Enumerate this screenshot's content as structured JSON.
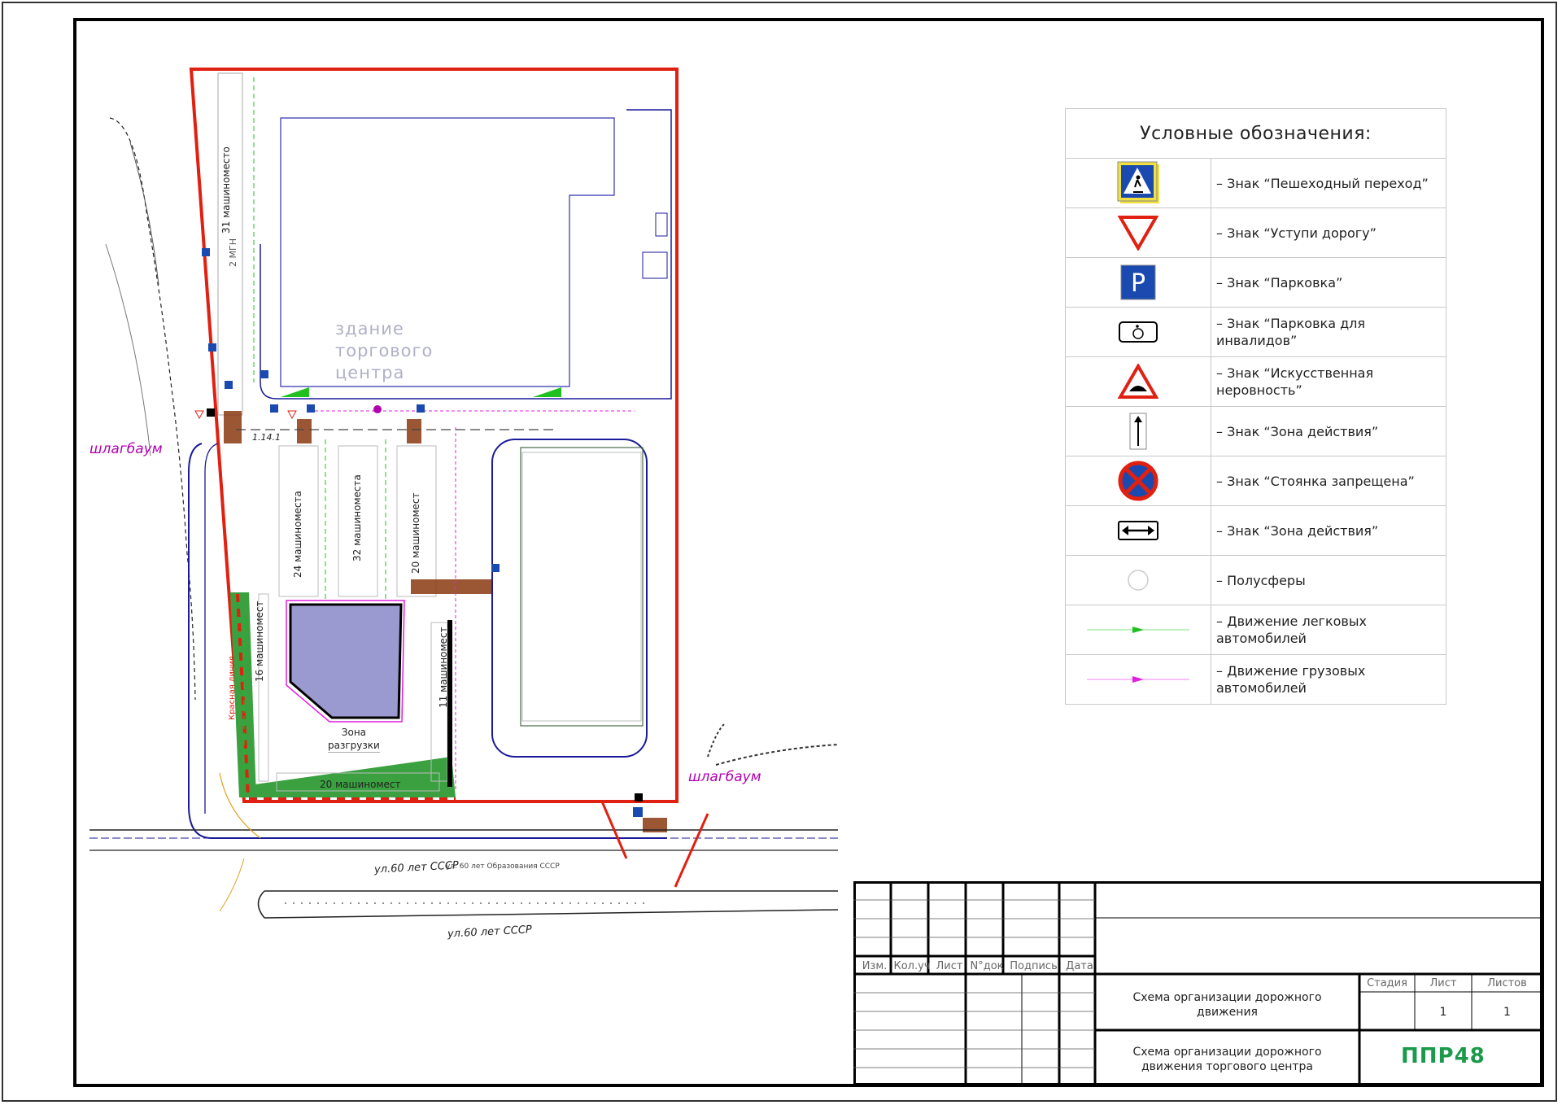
{
  "plan": {
    "building_label": "здание\nторгового\nцентра",
    "barrier_left": "шлагбаум",
    "barrier_right": "шлагбаум",
    "parking_31": "31 машиноместо",
    "parking_24": "24 машиноместа",
    "parking_32": "32 машиноместа",
    "parking_20_vert": "20 машиномест",
    "parking_16": "16 машиномест",
    "parking_11": "11 машиномест",
    "parking_20_horiz": "20 машиномест",
    "mgn": "2 МГН",
    "unload_zone": "Зона\nразгрузки",
    "sign_1141": "1.14.1",
    "red_line": "Красная линия",
    "street_main": "ул.60 лет СССР",
    "street_small": "ул. 60 лет Образования СССР",
    "street_bottom": "ул.60 лет СССР"
  },
  "legend": {
    "title": "Условные обозначения:",
    "items": [
      {
        "icon": "pedestrian-crossing-sign",
        "text": "– Знак “Пешеходный переход”"
      },
      {
        "icon": "give-way-sign",
        "text": "– Знак “Уступи дорогу”"
      },
      {
        "icon": "parking-sign",
        "text": "– Знак “Парковка”"
      },
      {
        "icon": "disabled-parking-sign",
        "text": "– Знак “Парковка для\nинвалидов”"
      },
      {
        "icon": "speed-bump-sign",
        "text": "– Знак “Искусственная\nнеровность”"
      },
      {
        "icon": "zone-arrow-sign",
        "text": "– Знак “Зона действия”"
      },
      {
        "icon": "no-stopping-sign",
        "text": "– Знак “Стоянка запрещена”"
      },
      {
        "icon": "zone-double-arrow-sign",
        "text": "– Знак “Зона действия”"
      },
      {
        "icon": "hemisphere-symbol",
        "text": "– Полусферы"
      },
      {
        "icon": "car-traffic-line",
        "text": "– Движение легковых\nавтомобилей"
      },
      {
        "icon": "truck-traffic-line",
        "text": "– Движение грузовых\nавтомобилей"
      }
    ]
  },
  "title_block": {
    "col_headers": [
      "Изм.",
      "Кол.уч",
      "Лист",
      "N°док",
      "Подпись",
      "Дата"
    ],
    "stage_header": "Стадия",
    "sheet_header": "Лист",
    "sheets_header": "Листов",
    "sheet": "1",
    "sheets": "1",
    "doc_title": "Схема организации дорожного\nдвижения",
    "sheet_title": "Схема организации дорожного\nдвижения торгового центра",
    "company": "ППР48"
  },
  "colors": {
    "boundary": "#e02010",
    "road": "#1a1a9a",
    "car_flow": "#20c020",
    "truck_flow": "#e020e0",
    "green_area": "#3aa040",
    "warehouse_fill": "#9a9ad0",
    "logo": "#1a9a4a"
  }
}
